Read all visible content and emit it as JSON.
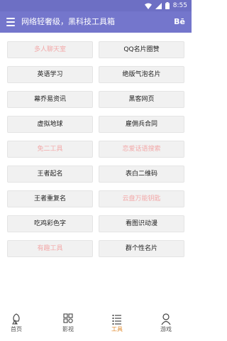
{
  "status_bar": {
    "time": "8:55",
    "icons": [
      "wifi-icon",
      "signal-icon",
      "battery-icon"
    ]
  },
  "app_bar": {
    "title": "网络轻奢级，黑科技工具箱",
    "action": "Bē"
  },
  "tools": [
    {
      "label": "多人聊天室",
      "faded": true
    },
    {
      "label": "QQ名片圈赞",
      "faded": false
    },
    {
      "label": "英语学习",
      "faded": false
    },
    {
      "label": "绝版气泡名片",
      "faded": false
    },
    {
      "label": "幕乔易资讯",
      "faded": false
    },
    {
      "label": "黑客网页",
      "faded": false
    },
    {
      "label": "虚拟地球",
      "faded": false
    },
    {
      "label": "雇佣兵合同",
      "faded": false
    },
    {
      "label": "免二工具",
      "faded": true
    },
    {
      "label": "恋爱话语搜索",
      "faded": true
    },
    {
      "label": "王者起名",
      "faded": false
    },
    {
      "label": "表白二维码",
      "faded": false
    },
    {
      "label": "王者重复名",
      "faded": false
    },
    {
      "label": "云盘万能钥匙",
      "faded": true
    },
    {
      "label": "吃鸡彩色字",
      "faded": false
    },
    {
      "label": "看图识动漫",
      "faded": false
    },
    {
      "label": "有趣工具",
      "faded": true
    },
    {
      "label": "群个性名片",
      "faded": false
    }
  ],
  "bottom_nav": [
    {
      "label": "首页",
      "icon": "home-icon",
      "active": false
    },
    {
      "label": "影视",
      "icon": "video-icon",
      "active": false
    },
    {
      "label": "工具",
      "icon": "tools-icon",
      "active": true
    },
    {
      "label": "游戏",
      "icon": "game-icon",
      "active": false
    }
  ],
  "colors": {
    "status_bar": "#6d6fc4",
    "app_bar": "#7476cc",
    "faded_text": "#f2a9a9",
    "active_tab": "#e08a2c"
  }
}
